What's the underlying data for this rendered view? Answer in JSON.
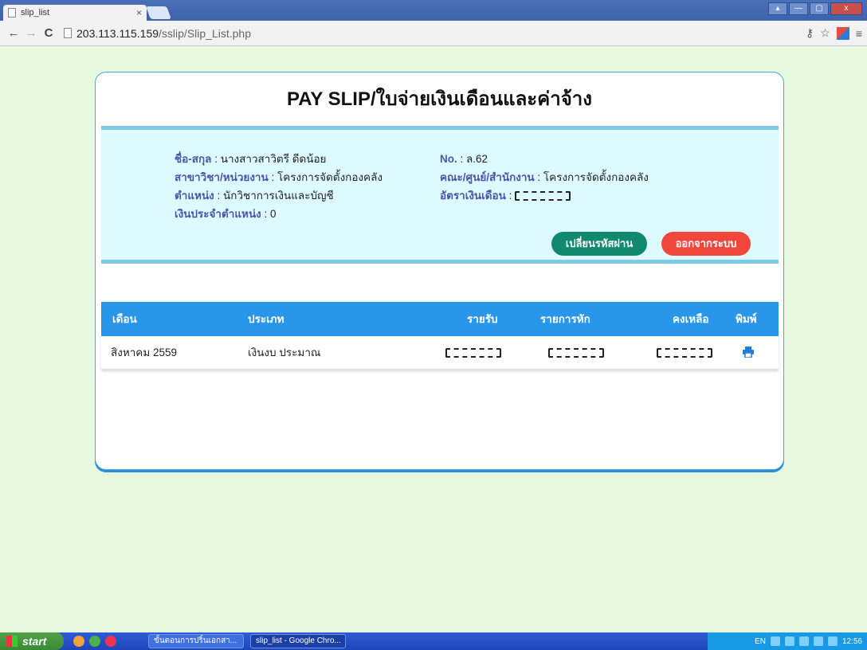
{
  "browser": {
    "tab_title": "slip_list",
    "tab_close": "×",
    "url_host": "203.113.115.159",
    "url_path": "/sslip/Slip_List.php",
    "back": "←",
    "forward": "→",
    "reload": "C"
  },
  "page": {
    "title": "PAY SLIP/ใบจ่ายเงินเดือนและค่าจ้าง"
  },
  "employee": {
    "name_label": "ชื่อ-สกุล",
    "name_value": ": นางสาวสาวิตรี ดีดน้อย",
    "dept_label": "สาขาวิชา/หน่วยงาน",
    "dept_value": ": โครงการจัดตั้งกองคลัง",
    "position_label": "ตำแหน่ง",
    "position_value": ": นักวิชาการเงินและบัญชี",
    "allowance_label": "เงินประจำตำแหน่ง",
    "allowance_value": ": 0",
    "no_label": "No.",
    "no_value": ": ล.62",
    "faculty_label": "คณะ/ศูนย์/สำนักงาน",
    "faculty_value": ": โครงการจัดตั้งกองคลัง",
    "salary_label": "อัตราเงินเดือน",
    "salary_value": ": "
  },
  "buttons": {
    "change_password": "เปลี่ยนรหัสผ่าน",
    "logout": "ออกจากระบบ"
  },
  "table": {
    "headers": [
      "เดือน",
      "ประเภท",
      "รายรับ",
      "รายการหัก",
      "คงเหลือ",
      "พิมพ์"
    ],
    "rows": [
      {
        "month": "สิงหาคม 2559",
        "type": "เงินงบ ประมาณ",
        "income": "",
        "deduction": "",
        "balance": ""
      }
    ]
  },
  "taskbar": {
    "start": "start",
    "task1": "ขั้นตอนการปริ้นเอกสา...",
    "task2": "slip_list - Google Chro...",
    "lang": "EN",
    "clock": "12:56"
  }
}
